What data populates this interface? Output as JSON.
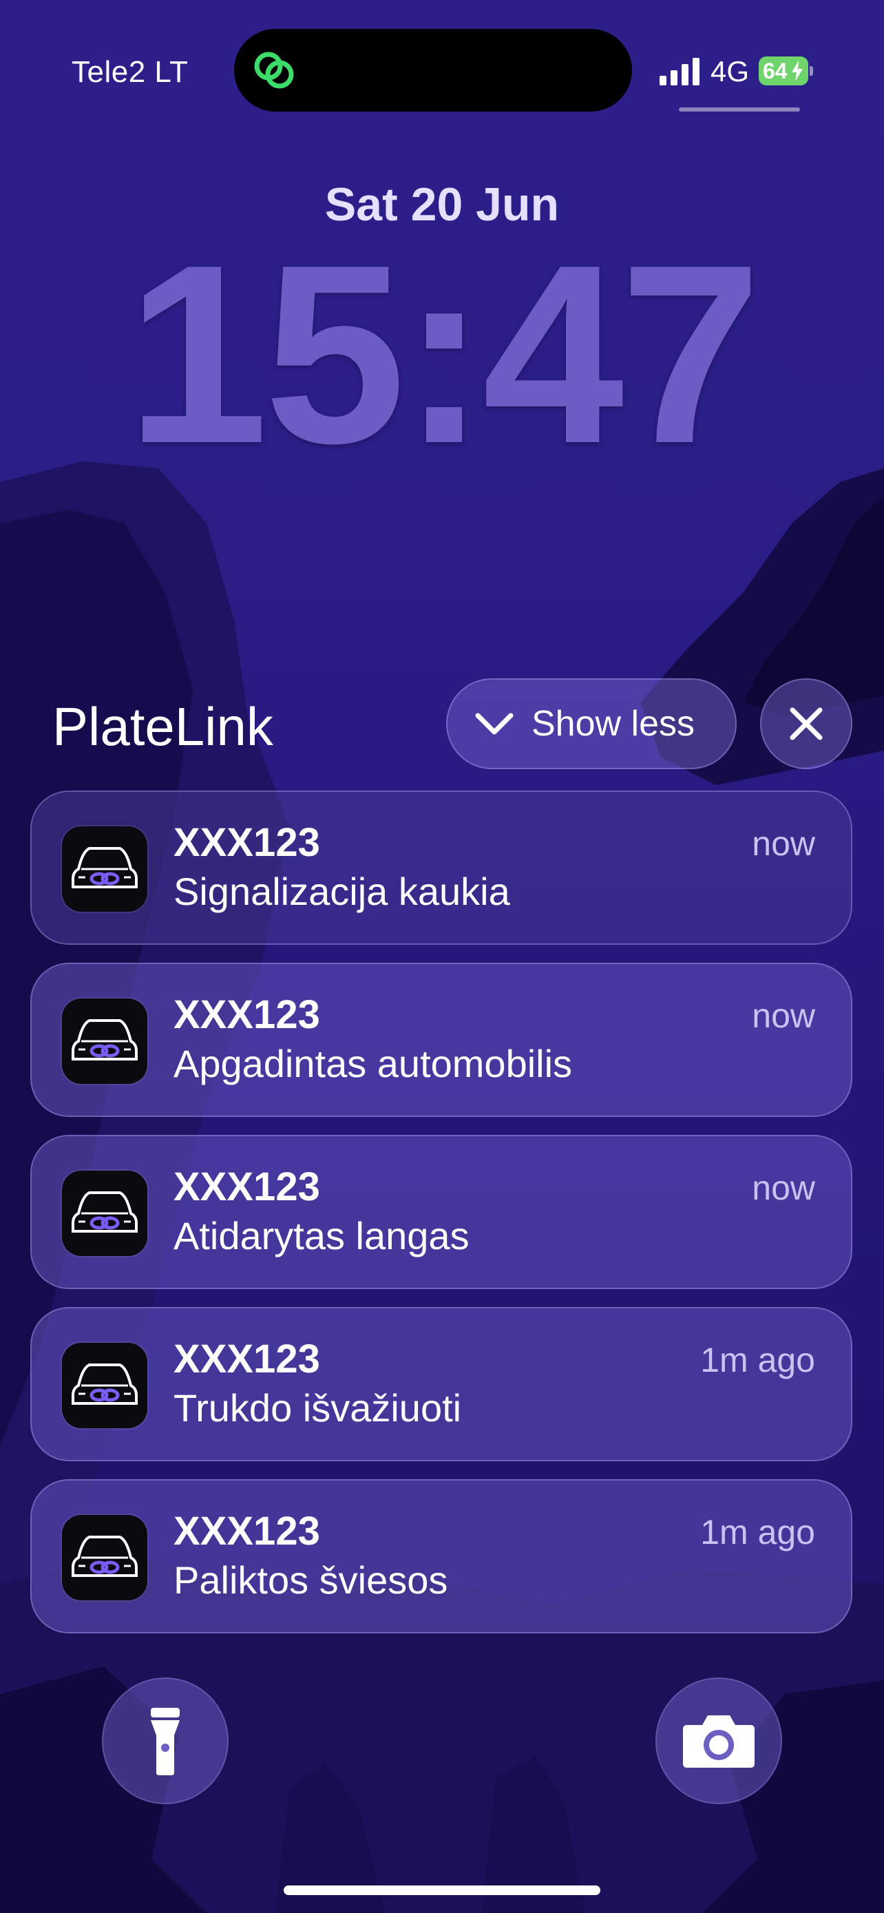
{
  "status_bar": {
    "carrier": "Tele2 LT",
    "network": "4G",
    "battery": "64",
    "battery_color": "#6ed46b",
    "dynamic_island_icon": "link-rings-icon",
    "dynamic_island_icon_color": "#3ddc6a"
  },
  "lock_screen": {
    "date": "Sat 20 Jun",
    "time": "15:47"
  },
  "notification_group": {
    "app_name": "PlateLink",
    "show_less_label": "Show less",
    "close_icon": "close-icon",
    "app_icon": "car-link-icon",
    "accent_color": "#7a5cf0"
  },
  "notifications": [
    {
      "title": "XXX123",
      "body": "Signalizacija kaukia",
      "time": "now"
    },
    {
      "title": "XXX123",
      "body": "Apgadintas automobilis",
      "time": "now"
    },
    {
      "title": "XXX123",
      "body": "Atidarytas langas",
      "time": "now"
    },
    {
      "title": "XXX123",
      "body": "Trukdo išvažiuoti",
      "time": "1m ago"
    },
    {
      "title": "XXX123",
      "body": "Paliktos šviesos",
      "time": "1m ago"
    }
  ],
  "quick_actions": {
    "left_icon": "flashlight-icon",
    "right_icon": "camera-icon"
  }
}
